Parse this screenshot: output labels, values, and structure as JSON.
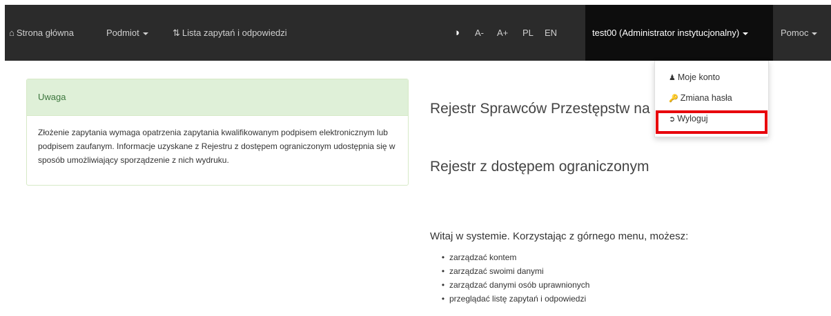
{
  "navbar": {
    "home": "Strona główna",
    "subject": "Podmiot",
    "requests": "Lista zapytań i odpowiedzi",
    "contrast": "◑",
    "font_smaller": "A-",
    "font_larger": "A+",
    "lang_pl": "PL",
    "lang_en": "EN",
    "user": "test00 (Administrator instytucjonalny)",
    "help": "Pomoc"
  },
  "user_menu": {
    "items": [
      "Moje konto",
      "Zmiana hasła",
      "Wyloguj"
    ]
  },
  "alert": {
    "title": "Uwaga",
    "body": "Złożenie zapytania wymaga opatrzenia zapytania kwalifikowanym podpisem elektronicznym lub podpisem zaufanym. Informacje uzyskane z Rejestru z dostępem ograniczonym udostępnia się w sposób umożliwiający sporządzenie z nich wydruku."
  },
  "main": {
    "title": "Rejestr Sprawców Przestępstw na",
    "subtitle": "Rejestr z dostępem ograniczonym",
    "welcome": "Witaj w systemie. Korzystając z górnego menu, możesz:",
    "features": [
      "zarządzać kontem",
      "zarządzać swoimi danymi",
      "zarządzać danymi osób uprawnionych",
      "przeglądać listę zapytań i odpowiedzi"
    ]
  },
  "colors": {
    "navbar_bg": "#2b2b2b",
    "user_bg": "#0d0d0d",
    "alert_head_bg": "#dff0d8",
    "alert_text": "#3c763d",
    "highlight": "#e8000b"
  }
}
